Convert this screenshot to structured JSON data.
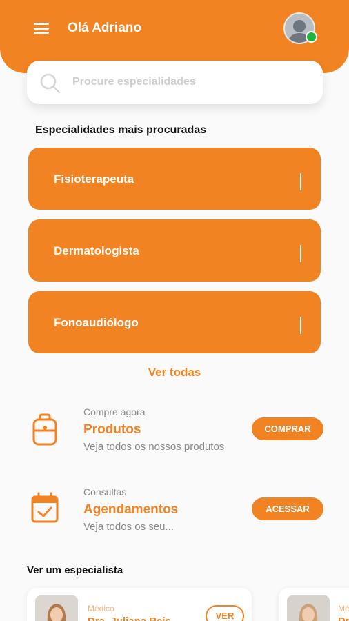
{
  "header": {
    "greeting": "Olá Adriano"
  },
  "search": {
    "placeholder": "Procure especialidades"
  },
  "specialties": {
    "title": "Especialidades mais procuradas",
    "items": [
      "Fisioterapeuta",
      "Dermatologista",
      "Fonoaudiólogo"
    ],
    "see_all": "Ver todas"
  },
  "features": [
    {
      "small": "Compre agora",
      "title": "Produtos",
      "desc": "Veja todos os nossos produtos",
      "button": "COMPRAR"
    },
    {
      "small": "Consultas",
      "title": "Agendamentos",
      "desc": "Veja todos  os seu...",
      "button": "ACESSAR"
    }
  ],
  "specialists": {
    "title": "Ver um especialista",
    "cards": [
      {
        "role": "Médico",
        "name": "Dra. Juliana Reis",
        "button": "VER"
      },
      {
        "role": "Médico",
        "name": "Dr"
      }
    ]
  },
  "colors": {
    "accent": "#f28322",
    "online": "#19b83c"
  }
}
